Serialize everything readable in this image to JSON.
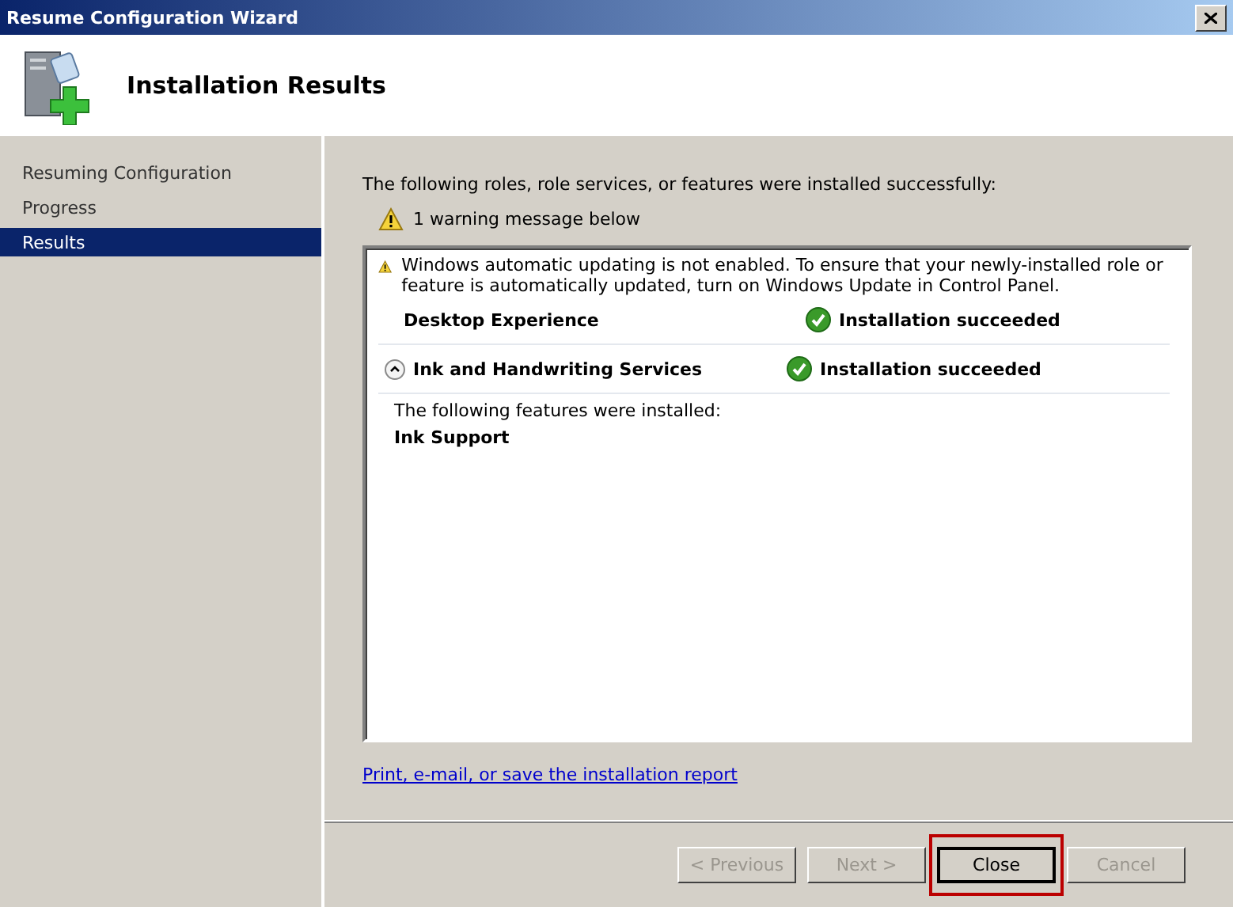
{
  "window": {
    "title": "Resume Configuration Wizard"
  },
  "header": {
    "title": "Installation Results"
  },
  "sidebar": {
    "items": [
      {
        "label": "Resuming Configuration",
        "selected": false
      },
      {
        "label": "Progress",
        "selected": false
      },
      {
        "label": "Results",
        "selected": true
      }
    ]
  },
  "content": {
    "intro": "The following roles, role services, or features were installed successfully:",
    "warning_summary": "1 warning message below",
    "results": {
      "warning": "Windows automatic updating is not enabled. To ensure that your newly-installed role or feature is automatically updated, turn on Windows Update in Control Panel.",
      "items": [
        {
          "kind": "plain",
          "name": "Desktop Experience",
          "status": "Installation succeeded"
        },
        {
          "kind": "expandable",
          "expanded": true,
          "name": "Ink and Handwriting Services",
          "status": "Installation succeeded",
          "details": "The following features were installed:",
          "features": [
            "Ink Support"
          ]
        }
      ]
    },
    "report_link": "Print, e-mail, or save the installation report"
  },
  "buttons": [
    {
      "label": "< Previous",
      "disabled": true,
      "highlighted": false
    },
    {
      "label": "Next >",
      "disabled": true,
      "highlighted": false
    },
    {
      "label": "Close",
      "disabled": false,
      "highlighted": true
    },
    {
      "label": "Cancel",
      "disabled": true,
      "highlighted": false
    }
  ]
}
